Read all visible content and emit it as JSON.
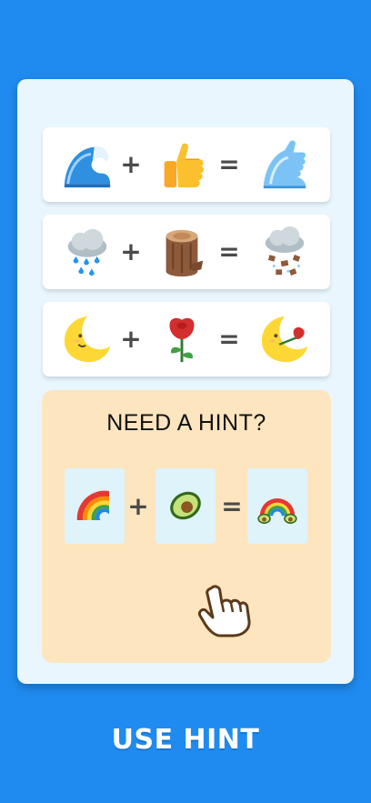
{
  "equations": [
    {
      "a": "wave",
      "b": "thumbs-up",
      "result": "wave-thumbs-up"
    },
    {
      "a": "cloud-with-rain",
      "b": "wood-log",
      "result": "cloud-raining-wood"
    },
    {
      "a": "crescent-moon-face",
      "b": "rose",
      "result": "moon-face-with-rose"
    }
  ],
  "operators": {
    "plus": "+",
    "equals": "="
  },
  "hint": {
    "title": "NEED A HINT?",
    "a": "rainbow",
    "b": "avocado",
    "result": "rainbow-avocado"
  },
  "button": {
    "label": "USE HINT"
  },
  "colors": {
    "background": "#1f8bf0",
    "panel": "#e9f6fd",
    "hint_box": "#fce5bf"
  }
}
